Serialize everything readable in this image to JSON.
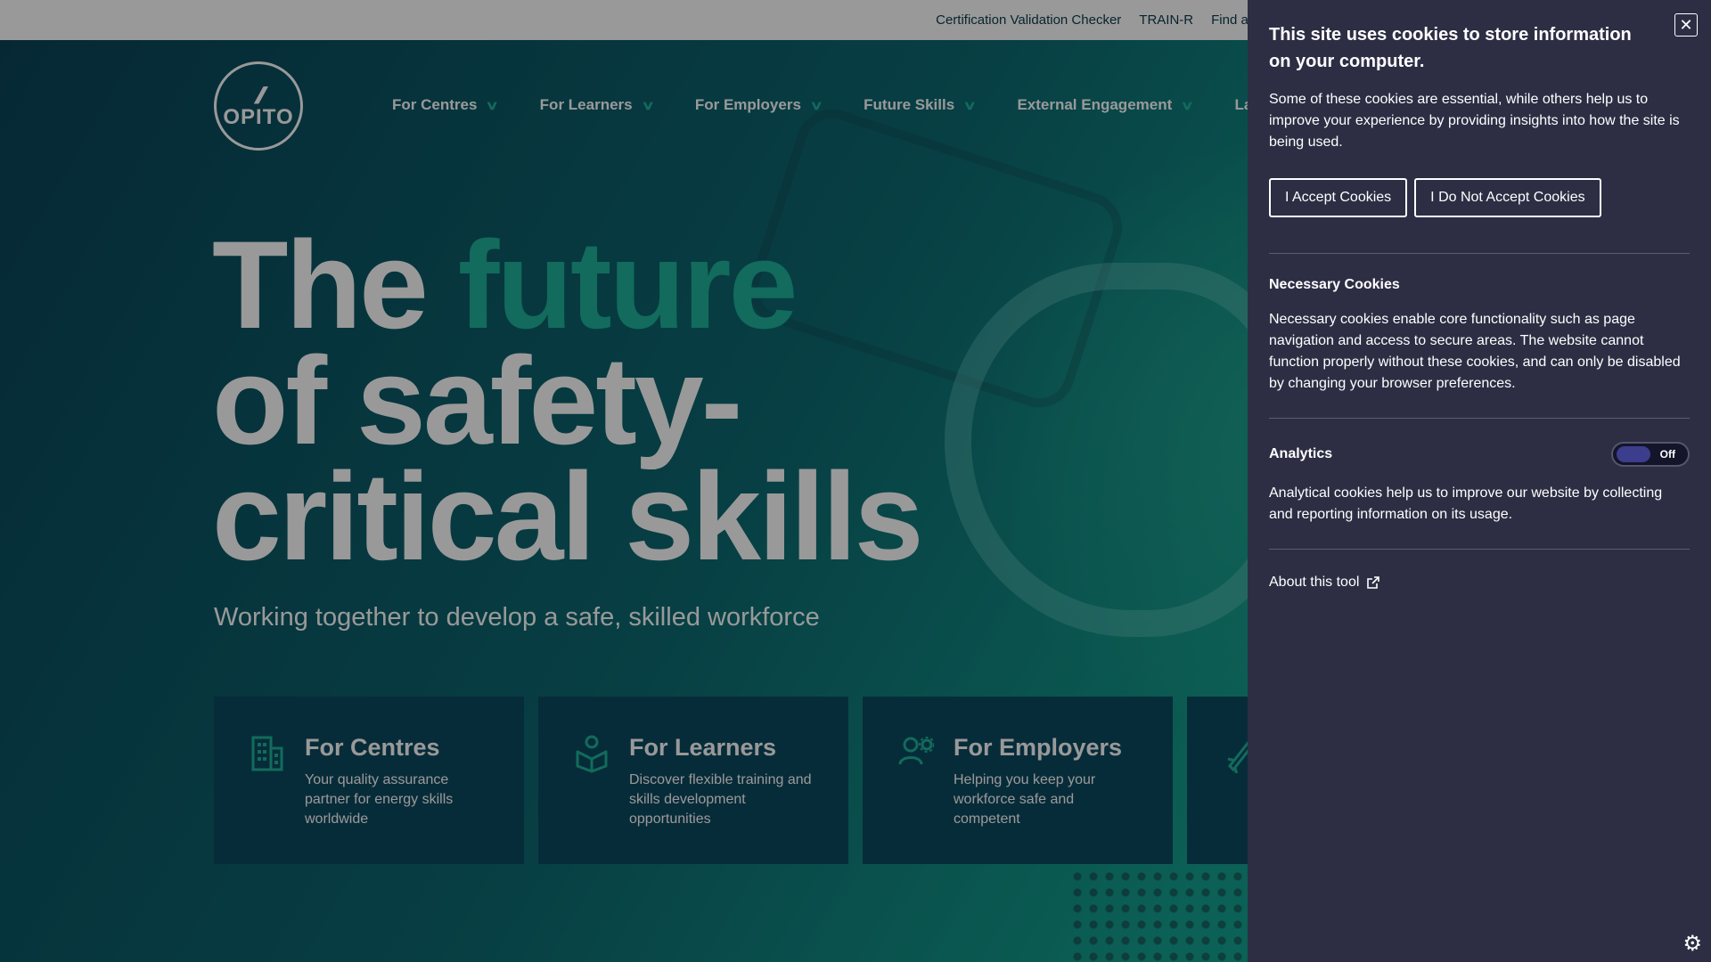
{
  "topbar": {
    "links": [
      "Certification Validation Checker",
      "TRAIN-R",
      "Find a Centre"
    ]
  },
  "logo": {
    "text": "OPITO"
  },
  "nav": {
    "items": [
      "For Centres",
      "For Learners",
      "For Employers",
      "Future Skills",
      "External Engagement",
      "Lates"
    ]
  },
  "hero": {
    "headline_the": "The",
    "headline_future": "future",
    "headline_line2": "of safety-",
    "headline_line3": "critical skills",
    "subheadline": "Working together to develop a safe, skilled workforce"
  },
  "cards": [
    {
      "title": "For Centres",
      "description": "Your quality assurance partner for energy skills worldwide",
      "icon": "building-icon"
    },
    {
      "title": "For Learners",
      "description": "Discover flexible training and skills development opportunities",
      "icon": "learner-book-icon"
    },
    {
      "title": "For Employers",
      "description": "Helping you keep your workforce safe and competent",
      "icon": "employer-gear-icon"
    },
    {
      "title": "",
      "description": "",
      "icon": "rocket-icon"
    }
  ],
  "cookie_panel": {
    "title": "This site uses cookies to store information on your computer.",
    "intro": "Some of these cookies are essential, while others help us to improve your experience by providing insights into how the site is being used.",
    "accept_label": "I Accept Cookies",
    "reject_label": "I Do Not Accept Cookies",
    "necessary_title": "Necessary Cookies",
    "necessary_body": "Necessary cookies enable core functionality such as page navigation and access to secure areas. The website cannot function properly without these cookies, and can only be disabled by changing your browser preferences.",
    "analytics_title": "Analytics",
    "analytics_toggle_label": "Off",
    "analytics_body": "Analytical cookies help us to improve our website by collecting and reporting information on its usage.",
    "about_label": "About this tool"
  },
  "colors": {
    "accent_teal": "#1fb39a",
    "panel_bg": "#2d2e44",
    "card_bg": "#0c4a60"
  }
}
